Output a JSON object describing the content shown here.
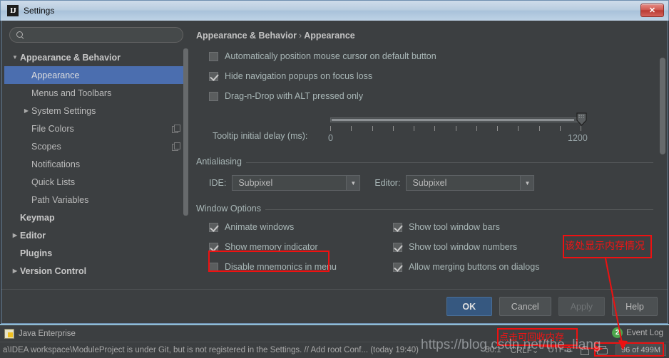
{
  "window": {
    "title": "Settings",
    "app_icon": "intellij-idea-icon",
    "close_label": "✕"
  },
  "search": {
    "placeholder": "",
    "value": "",
    "icon": "search-icon"
  },
  "sidebar": {
    "items": [
      {
        "label": "Appearance & Behavior",
        "level": 0,
        "twisty": "▼",
        "bold": true,
        "selected": false,
        "copy": false
      },
      {
        "label": "Appearance",
        "level": 1,
        "twisty": "",
        "bold": false,
        "selected": true,
        "copy": false
      },
      {
        "label": "Menus and Toolbars",
        "level": 1,
        "twisty": "",
        "bold": false,
        "selected": false,
        "copy": false
      },
      {
        "label": "System Settings",
        "level": 1,
        "twisty": "▶",
        "bold": false,
        "selected": false,
        "copy": false
      },
      {
        "label": "File Colors",
        "level": 1,
        "twisty": "",
        "bold": false,
        "selected": false,
        "copy": true
      },
      {
        "label": "Scopes",
        "level": 1,
        "twisty": "",
        "bold": false,
        "selected": false,
        "copy": true
      },
      {
        "label": "Notifications",
        "level": 1,
        "twisty": "",
        "bold": false,
        "selected": false,
        "copy": false
      },
      {
        "label": "Quick Lists",
        "level": 1,
        "twisty": "",
        "bold": false,
        "selected": false,
        "copy": false
      },
      {
        "label": "Path Variables",
        "level": 1,
        "twisty": "",
        "bold": false,
        "selected": false,
        "copy": false
      },
      {
        "label": "Keymap",
        "level": 0,
        "twisty": "",
        "bold": true,
        "selected": false,
        "copy": false
      },
      {
        "label": "Editor",
        "level": 0,
        "twisty": "▶",
        "bold": true,
        "selected": false,
        "copy": false
      },
      {
        "label": "Plugins",
        "level": 0,
        "twisty": "",
        "bold": true,
        "selected": false,
        "copy": false
      },
      {
        "label": "Version Control",
        "level": 0,
        "twisty": "▶",
        "bold": true,
        "selected": false,
        "copy": false
      }
    ]
  },
  "breadcrumb": {
    "root": "Appearance & Behavior",
    "separator": "›",
    "leaf": "Appearance"
  },
  "main": {
    "top_checkboxes": [
      {
        "label": "Automatically position mouse cursor on default button",
        "checked": false
      },
      {
        "label": "Hide navigation popups on focus loss",
        "checked": true
      },
      {
        "label": "Drag-n-Drop with ALT pressed only",
        "checked": false
      }
    ],
    "slider": {
      "label": "Tooltip initial delay (ms):",
      "min_label": "0",
      "max_label": "1200",
      "min": 0,
      "max": 1200,
      "value": 1200,
      "tick_count": 13
    },
    "antialiasing": {
      "group_title": "Antialiasing",
      "ide_label": "IDE:",
      "ide_value": "Subpixel",
      "editor_label": "Editor:",
      "editor_value": "Subpixel",
      "arrow": "▼"
    },
    "window_options": {
      "group_title": "Window Options",
      "left_column": [
        {
          "label": "Animate windows",
          "checked": true
        },
        {
          "label": "Show memory indicator",
          "checked": true
        },
        {
          "label": "Disable mnemonics in menu",
          "checked": false
        }
      ],
      "right_column": [
        {
          "label": "Show tool window bars",
          "checked": true
        },
        {
          "label": "Show tool window numbers",
          "checked": true
        },
        {
          "label": "Allow merging buttons on dialogs",
          "checked": true
        }
      ]
    }
  },
  "buttons": {
    "ok": "OK",
    "cancel": "Cancel",
    "apply": "Apply",
    "help": "Help"
  },
  "ide_status": {
    "tool_window": "Java Enterprise",
    "event_log": "Event Log",
    "event_log_count": "2",
    "message": "a\\IDEA workspace\\ModuleProject is under Git, but is not registered in the Settings. // Add root  Conf... (today 19:40)",
    "caret": "50:1",
    "line_separator": "CRLF",
    "line_separator_arrow": "⌄",
    "encoding": "UTF-8",
    "lock_icon": "lock-icon",
    "cursor_icon": "cursor-icon",
    "memory": "96 of 499M"
  },
  "annotations": {
    "memory_note": "该处显示内存情况",
    "reclaim_note": "点击可回收内存",
    "watermark": "https://blog.csdn.net/the_liang",
    "highlight_color": "#ee1111"
  }
}
